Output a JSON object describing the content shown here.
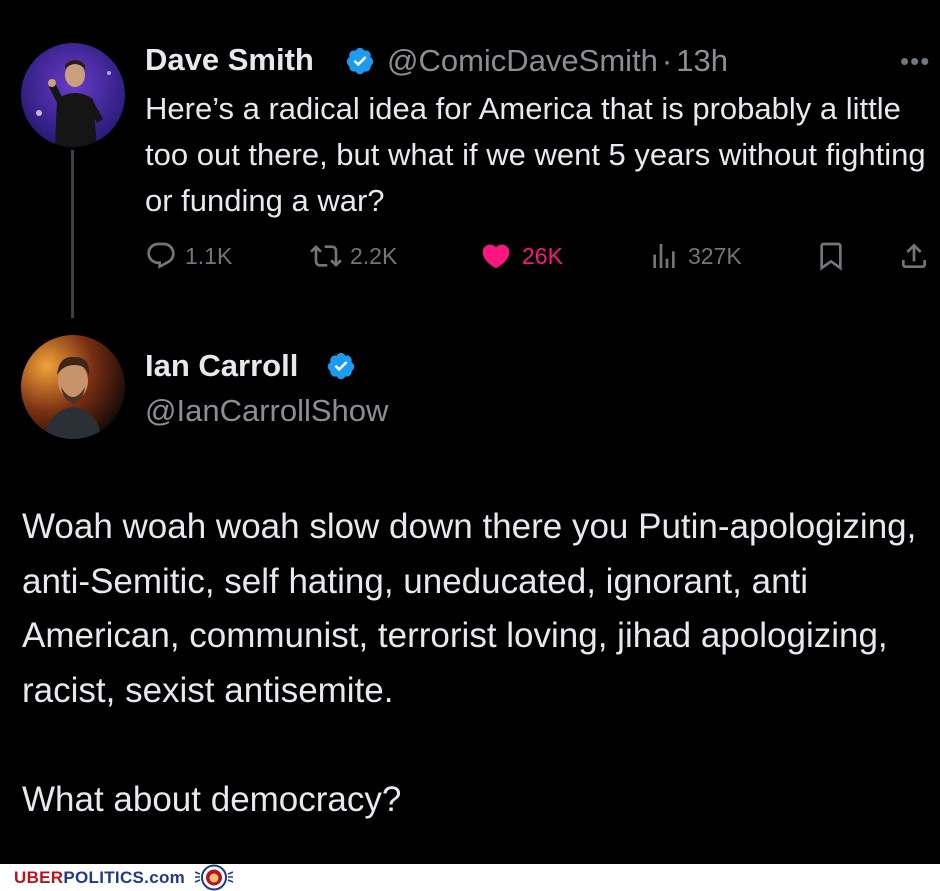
{
  "tweet1": {
    "author_name": "Dave Smith",
    "handle": "@ComicDaveSmith",
    "separator": "·",
    "time": "13h",
    "more": "•••",
    "text": "Here’s a radical idea for America that is probably a little too out there, but what if we went 5 years without fighting or funding a war?",
    "stats": {
      "replies": "1.1K",
      "reposts": "2.2K",
      "likes": "26K",
      "views": "327K"
    }
  },
  "tweet2": {
    "author_name": "Ian Carroll",
    "handle": "@IanCarrollShow",
    "paragraphs": [
      "Woah woah woah slow down there you Putin-apologizing, anti-Semitic, self hating, uneducated, ignorant, anti American, communist, terrorist loving, jihad apologizing, racist, sexist antisemite.",
      "What about democracy?"
    ]
  },
  "watermark": {
    "brand_part1": "UBER",
    "brand_part2": "POLITICS.com"
  },
  "colors": {
    "background": "#000000",
    "text": "#e7e9ea",
    "secondary": "#71767b",
    "verified": "#1d9bf0",
    "like": "#f91880"
  },
  "icons": [
    "verified-badge-icon",
    "more-icon",
    "reply-icon",
    "repost-icon",
    "heart-icon",
    "views-icon",
    "bookmark-icon",
    "share-icon"
  ]
}
